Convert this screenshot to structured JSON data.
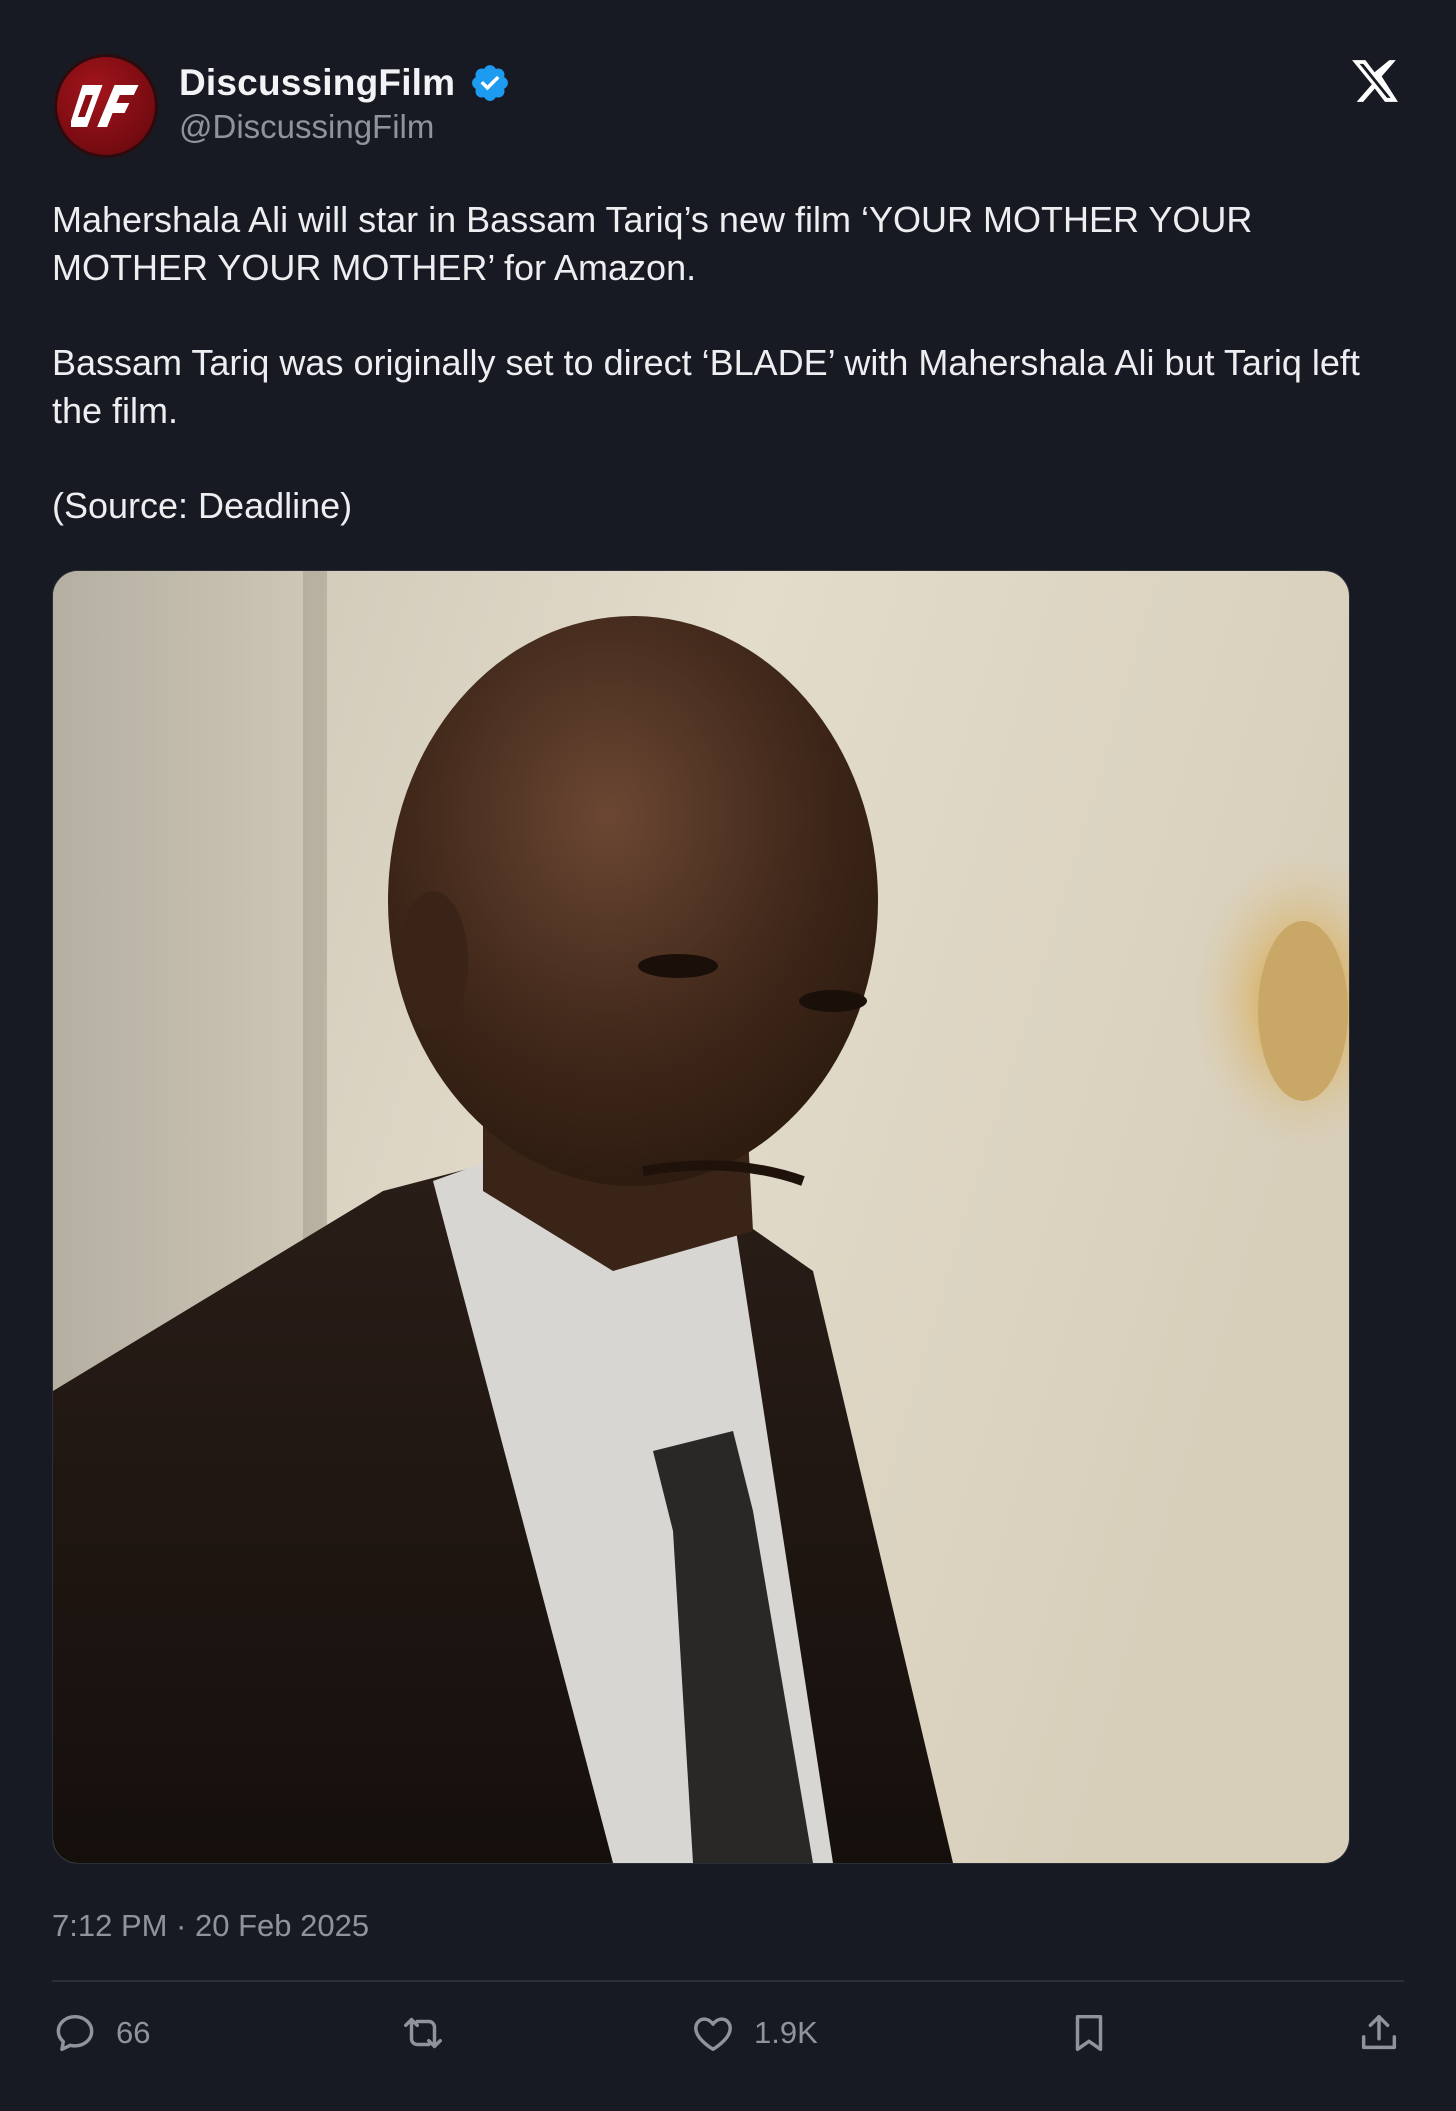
{
  "author": {
    "display_name": "DiscussingFilm",
    "handle": "@DiscussingFilm",
    "verified": true,
    "avatar_text": "DF"
  },
  "tweet": {
    "paragraphs": [
      "Mahershala Ali will star in Bassam Tariq’s new film ‘YOUR MOTHER YOUR MOTHER YOUR MOTHER’ for Amazon.",
      "Bassam Tariq was originally set to direct ‘BLADE’ with Mahershala Ali but Tariq left the film.",
      "(Source: Deadline)"
    ],
    "timestamp": "7:12 PM · 20 Feb 2025"
  },
  "actions": {
    "replies": "66",
    "retweets": "",
    "likes": "1.9K"
  },
  "icons": {
    "platform": "x-logo-icon",
    "verified": "verified-badge-icon",
    "reply": "reply-icon",
    "retweet": "retweet-icon",
    "like": "heart-icon",
    "bookmark": "bookmark-icon",
    "share": "share-icon"
  },
  "colors": {
    "background": "#171a23",
    "verified_blue": "#1d9bf0",
    "muted_text": "#8f949b",
    "brand_red": "#a3141c"
  }
}
